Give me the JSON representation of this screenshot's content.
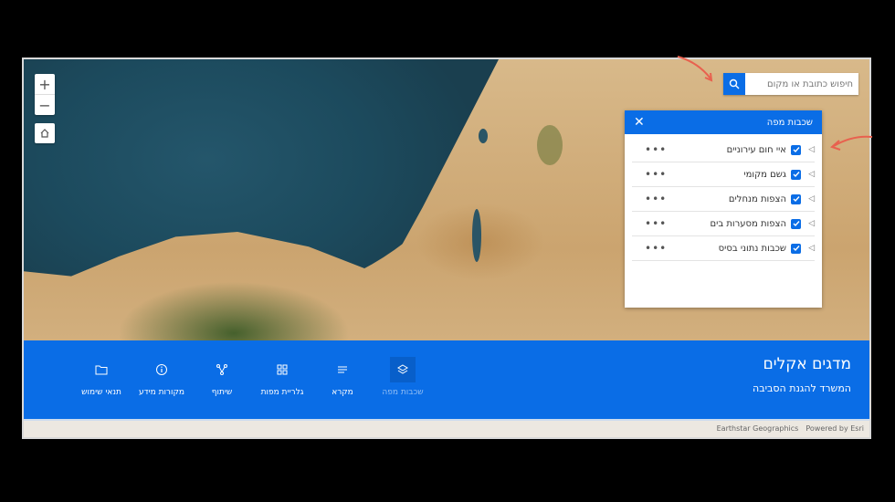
{
  "search": {
    "placeholder": "חיפוש כתובת או מקום"
  },
  "zoom": {
    "in_label": "+",
    "out_label": "−"
  },
  "layer_panel": {
    "title": "שכבות מפה",
    "layers": [
      {
        "label": "איי חום עירוניים"
      },
      {
        "label": "גשם מקומי"
      },
      {
        "label": "הצפות מנחלים"
      },
      {
        "label": "הצפות מסערות בים"
      },
      {
        "label": "שכבות נתוני בסיס"
      }
    ],
    "more_label": "•••"
  },
  "header": {
    "title": "מדגים אקלים",
    "subtitle": "המשרד להגנת הסביבה"
  },
  "toolbar": {
    "items": [
      {
        "label": "שכבות מפה",
        "icon": "layers-icon",
        "active": true
      },
      {
        "label": "מקרא",
        "icon": "legend-icon"
      },
      {
        "label": "גלריית מפות",
        "icon": "gallery-icon"
      },
      {
        "label": "שיתוף",
        "icon": "share-icon"
      },
      {
        "label": "מקורות מידע",
        "icon": "info-icon"
      },
      {
        "label": "תנאי שימוש",
        "icon": "folder-icon"
      }
    ]
  },
  "attribution": {
    "source": "Earthstar Geographics",
    "powered": "Powered by Esri"
  },
  "colors": {
    "accent": "#0a6de6",
    "annotation": "#e8614f"
  }
}
